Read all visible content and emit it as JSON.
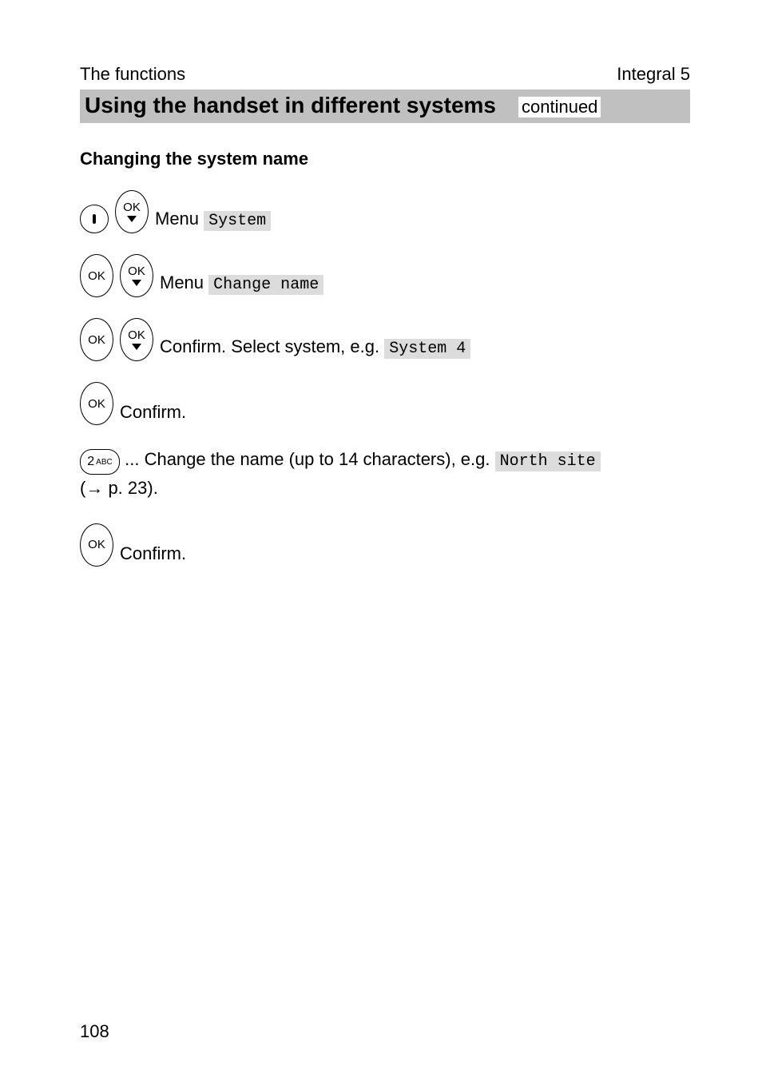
{
  "header": {
    "left": "The functions",
    "right": "Integral 5"
  },
  "title": {
    "main": "Using the handset in different systems",
    "continued": "continued"
  },
  "subheading": "Changing the system name",
  "labels": {
    "menu": "Menu",
    "ok": "OK",
    "confirm": "Confirm.",
    "confirm_select": "Confirm. Select system, e.g.",
    "change_text_a": "... Change the name (up to 14 characters), e.g.",
    "page_ref": "(→ p. 23)."
  },
  "mono": {
    "system": "System",
    "change_name": "Change name",
    "system4": "System 4",
    "north_site": "North site"
  },
  "keypad": {
    "num": "2",
    "abc": "ABC"
  },
  "page_number": "108"
}
